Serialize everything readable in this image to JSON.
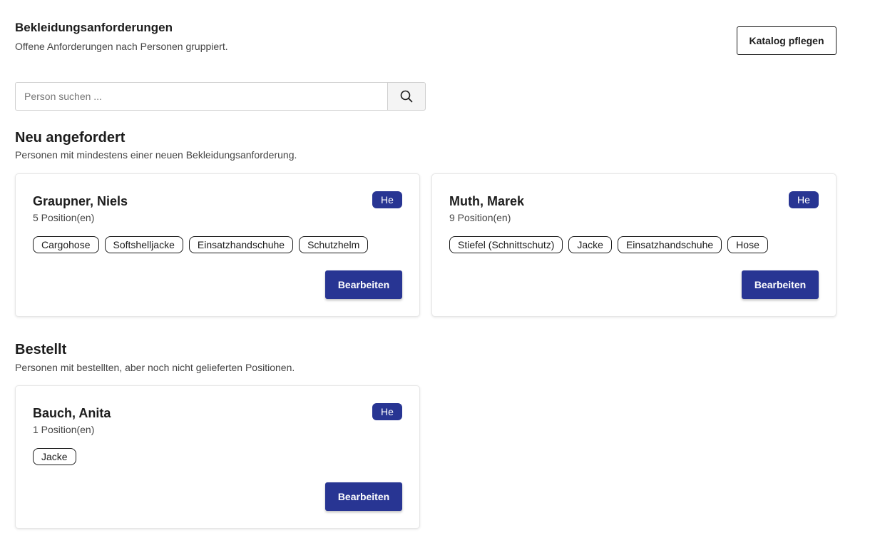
{
  "header": {
    "title": "Bekleidungsanforderungen",
    "subtitle": "Offene Anforderungen nach Personen gruppiert.",
    "catalog_button": "Katalog pflegen"
  },
  "search": {
    "placeholder": "Person suchen ...",
    "value": "",
    "icon": "search-icon"
  },
  "sections": [
    {
      "title": "Neu angefordert",
      "subtitle": "Personen mit mindestens einer neuen Bekleidungsanforderung.",
      "cards": [
        {
          "name": "Graupner, Niels",
          "count": "5 Position(en)",
          "badge": "He",
          "tags": [
            "Cargohose",
            "Softshelljacke",
            "Einsatzhandschuhe",
            "Schutzhelm"
          ],
          "button": "Bearbeiten"
        },
        {
          "name": "Muth, Marek",
          "count": "9 Position(en)",
          "badge": "He",
          "tags": [
            "Stiefel (Schnittschutz)",
            "Jacke",
            "Einsatzhandschuhe",
            "Hose"
          ],
          "button": "Bearbeiten"
        }
      ]
    },
    {
      "title": "Bestellt",
      "subtitle": "Personen mit bestellten, aber noch nicht gelieferten Positionen.",
      "cards": [
        {
          "name": "Bauch, Anita",
          "count": "1 Position(en)",
          "badge": "He",
          "tags": [
            "Jacke"
          ],
          "button": "Bearbeiten"
        }
      ]
    }
  ],
  "colors": {
    "primary": "#283593",
    "text": "#1c1c1c",
    "muted": "#444444"
  }
}
